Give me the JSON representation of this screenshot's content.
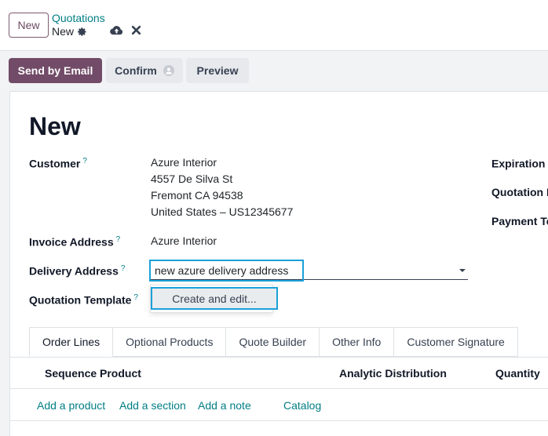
{
  "header": {
    "new_button": "New",
    "breadcrumb_parent": "Quotations",
    "breadcrumb_current": "New"
  },
  "actions": {
    "send_by_email": "Send by Email",
    "confirm": "Confirm",
    "preview": "Preview"
  },
  "form": {
    "title": "New",
    "customer_label": "Customer",
    "customer_address": [
      "Azure Interior",
      "4557 De Silva St",
      "Fremont CA 94538",
      "United States – US12345677"
    ],
    "invoice_address_label": "Invoice Address",
    "invoice_address_value": "Azure Interior",
    "delivery_address_label": "Delivery Address",
    "delivery_address_value": "new azure delivery address",
    "quotation_template_label": "Quotation Template",
    "dropdown_create_edit": "Create and edit...",
    "expiration_label": "Expiration",
    "quotation_date_label": "Quotation D",
    "payment_terms_label": "Payment Te",
    "help_mark": "?"
  },
  "tabs": [
    "Order Lines",
    "Optional Products",
    "Quote Builder",
    "Other Info",
    "Customer Signature"
  ],
  "table": {
    "columns": [
      "Sequence",
      "Product",
      "Analytic Distribution",
      "Quantity"
    ],
    "add_links": [
      "Add a product",
      "Add a section",
      "Add a note",
      "Catalog"
    ]
  },
  "colors": {
    "primary": "#714b67",
    "link": "#017e84",
    "focus": "#1ba1d8"
  },
  "icons": [
    "gear-icon",
    "cloud-upload-icon",
    "close-icon",
    "user-avatar-icon",
    "chevron-down-icon"
  ]
}
